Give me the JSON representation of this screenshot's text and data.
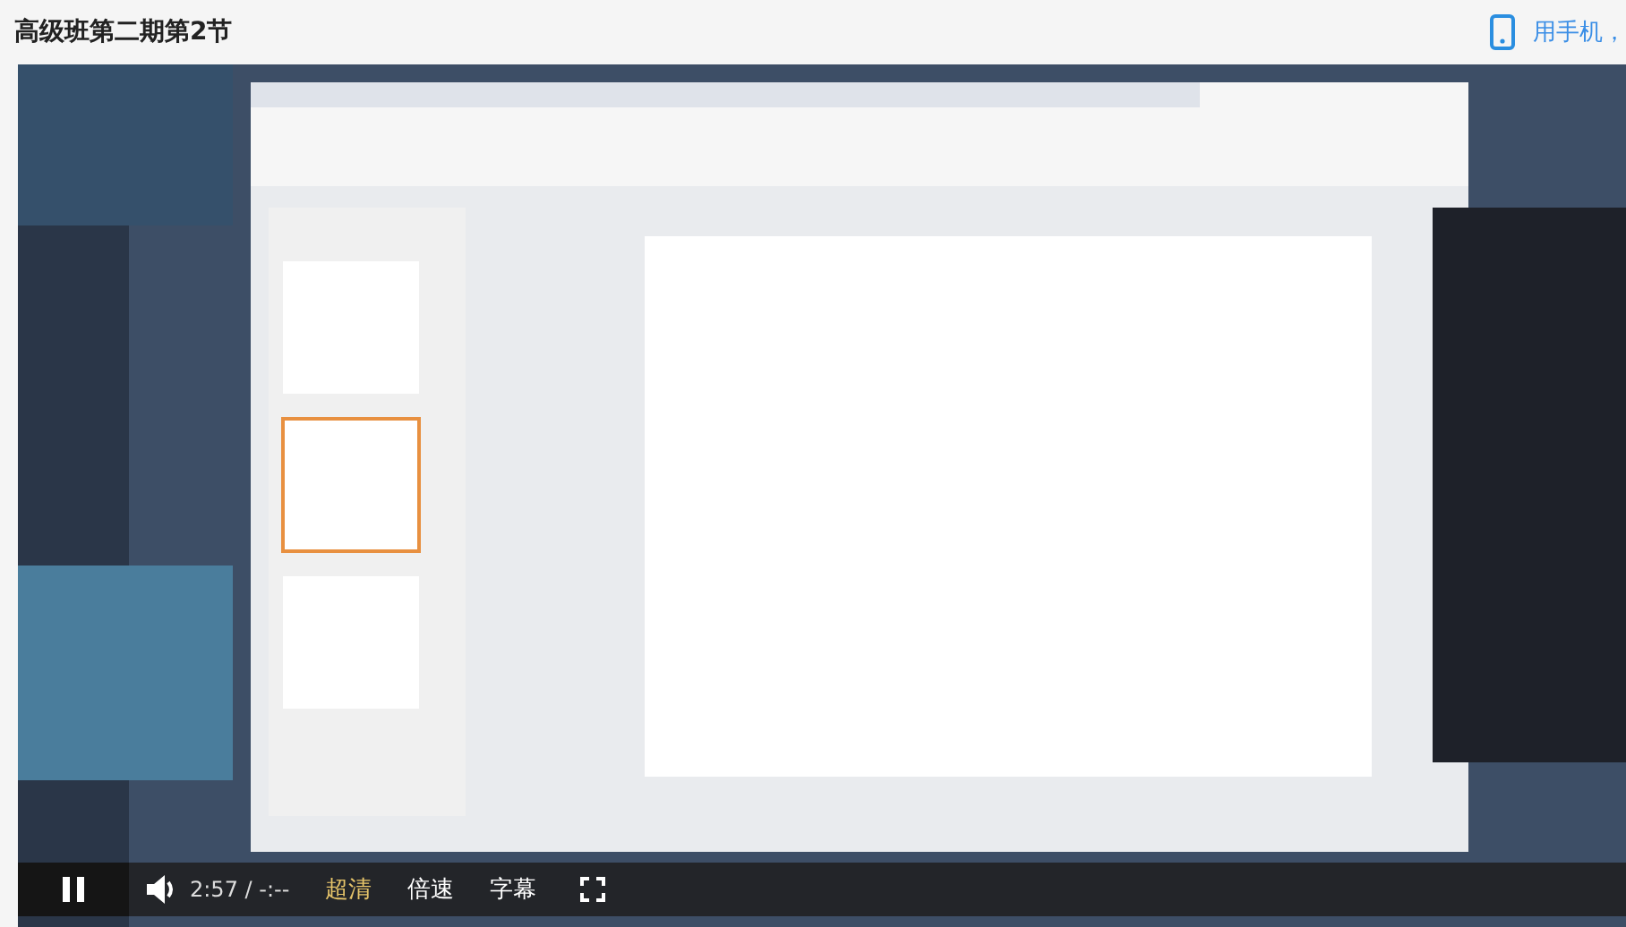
{
  "page": {
    "title": "高级班第二期第2节",
    "mobile_link": "用手机，"
  },
  "player": {
    "kind": "picture",
    "playing": true,
    "time": "2:57 / -:--",
    "quality": "超清",
    "speed": "倍速",
    "subtitles": "字幕"
  }
}
